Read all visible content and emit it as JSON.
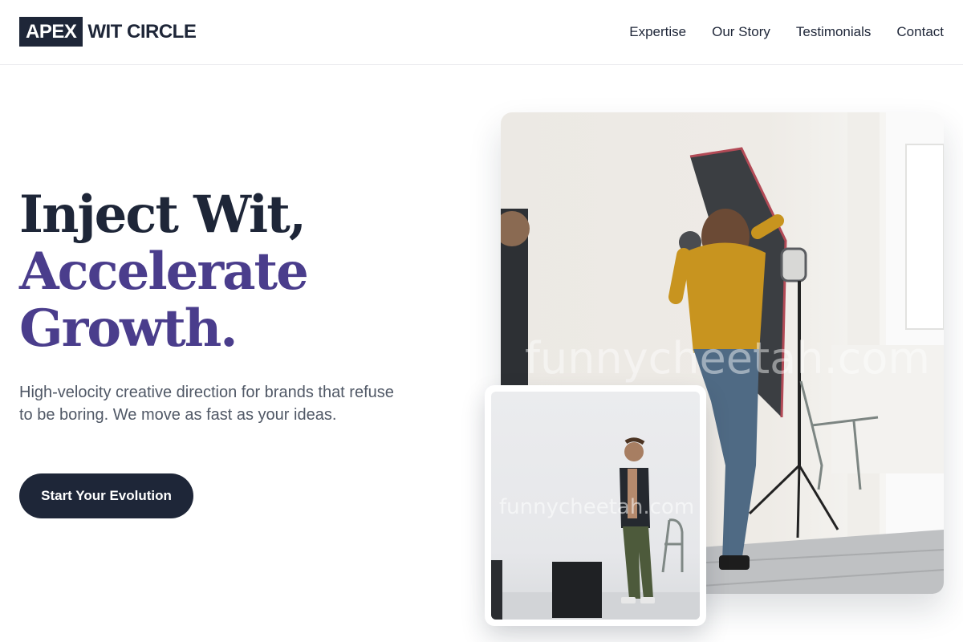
{
  "brand": {
    "logo_box": "APEX",
    "logo_rest": "WIT CIRCLE"
  },
  "nav": {
    "items": [
      {
        "label": "Expertise"
      },
      {
        "label": "Our Story"
      },
      {
        "label": "Testimonials"
      },
      {
        "label": "Contact"
      }
    ]
  },
  "hero": {
    "line1": "Inject Wit,",
    "line2": "Accelerate",
    "line3": "Growth.",
    "subtext": "High-velocity creative direction for brands that refuse to be boring. We move as fast as your ideas.",
    "cta_label": "Start Your Evolution"
  },
  "images": {
    "main_watermark": "funnycheetah.com",
    "inset_watermark": "funnycheetah.com"
  },
  "colors": {
    "primary": "#1e2638",
    "accent": "#4a3d8c",
    "body_text": "#505866"
  }
}
